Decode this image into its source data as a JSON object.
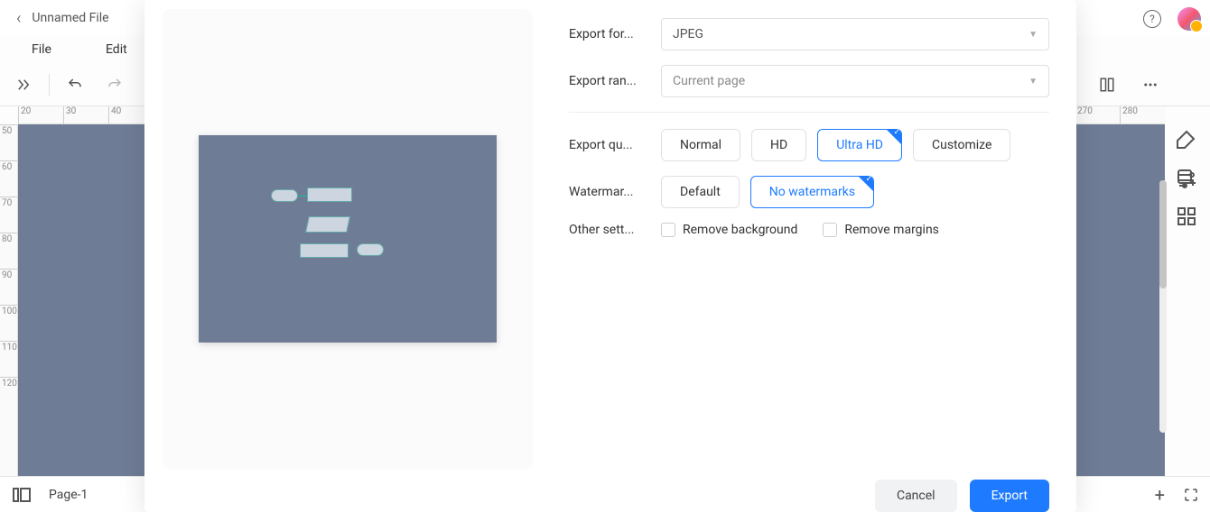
{
  "header": {
    "filename": "Unnamed File",
    "menu": {
      "file": "File",
      "edit": "Edit"
    }
  },
  "ruler_h": [
    "20",
    "30",
    "40",
    "",
    "",
    "",
    "",
    "",
    "",
    "",
    "",
    "",
    "",
    "",
    "",
    "",
    "",
    "",
    "",
    "",
    "",
    "",
    "",
    "",
    "270",
    "280"
  ],
  "ruler_v": [
    "50",
    "60",
    "70",
    "80",
    "90",
    "100",
    "110",
    "120"
  ],
  "status": {
    "page": "Page-1"
  },
  "export": {
    "format_label": "Export for...",
    "format_value": "JPEG",
    "range_label": "Export ran...",
    "range_value": "Current page",
    "quality_label": "Export qu...",
    "quality_options": [
      "Normal",
      "HD",
      "Ultra HD",
      "Customize"
    ],
    "quality_selected": "Ultra HD",
    "watermark_label": "Watermar...",
    "watermark_options": [
      "Default",
      "No watermarks"
    ],
    "watermark_selected": "No watermarks",
    "other_label": "Other sett...",
    "remove_bg": "Remove background",
    "remove_margins": "Remove margins",
    "cancel": "Cancel",
    "export_btn": "Export"
  }
}
